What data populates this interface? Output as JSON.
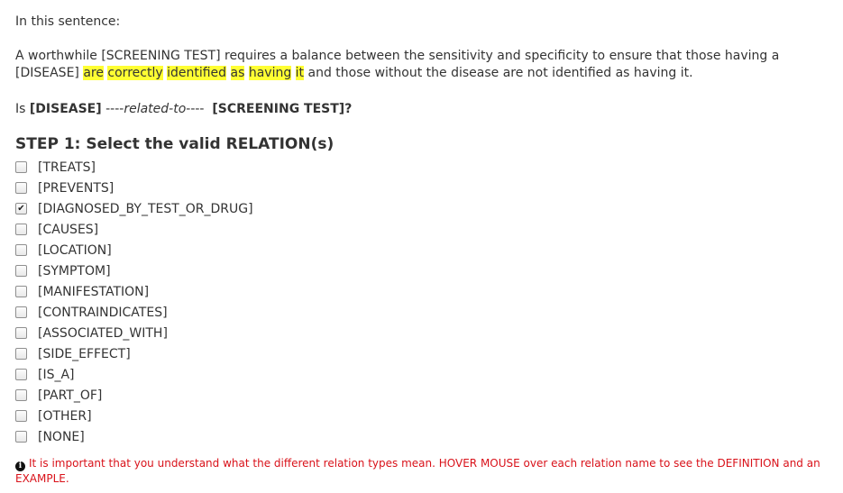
{
  "intro": "In this sentence:",
  "sentence": {
    "before": "A worthwhile [SCREENING TEST] requires a balance between the sensitivity and specificity to ensure that those having a [DISEASE] ",
    "highlighted": [
      "are",
      "correctly",
      "identified",
      "as",
      "having",
      "it"
    ],
    "after": " and those without the disease are not identified as having it."
  },
  "question": {
    "is": "Is",
    "entity1": "[DISEASE]",
    "pre_dashes": "----",
    "relation": "related-to",
    "post_dashes": "----",
    "entity2": "[SCREENING TEST]",
    "qmark": "?"
  },
  "step1": {
    "title": "STEP 1: Select the valid RELATION(s)",
    "options": [
      {
        "label": "[TREATS]",
        "checked": false
      },
      {
        "label": "[PREVENTS]",
        "checked": false
      },
      {
        "label": "[DIAGNOSED_BY_TEST_OR_DRUG]",
        "checked": true
      },
      {
        "label": "[CAUSES]",
        "checked": false
      },
      {
        "label": "[LOCATION]",
        "checked": false
      },
      {
        "label": "[SYMPTOM]",
        "checked": false
      },
      {
        "label": "[MANIFESTATION]",
        "checked": false
      },
      {
        "label": "[CONTRAINDICATES]",
        "checked": false
      },
      {
        "label": "[ASSOCIATED_WITH]",
        "checked": false
      },
      {
        "label": "[SIDE_EFFECT]",
        "checked": false
      },
      {
        "label": "[IS_A]",
        "checked": false
      },
      {
        "label": "[PART_OF]",
        "checked": false
      },
      {
        "label": "[OTHER]",
        "checked": false
      },
      {
        "label": "[NONE]",
        "checked": false
      }
    ]
  },
  "note": {
    "icon": "info-circle-icon",
    "text": "It is important that you understand what the different relation types mean. HOVER MOUSE over each relation name to see the DEFINITION and an EXAMPLE.",
    "color": "#d9121a"
  },
  "colors": {
    "highlight": "#ffff33",
    "text": "#333333"
  }
}
